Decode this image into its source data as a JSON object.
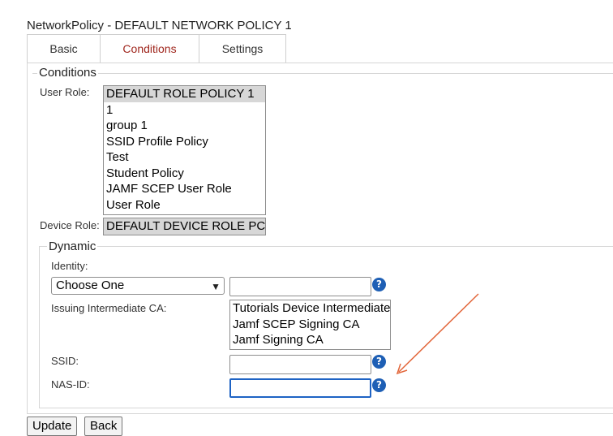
{
  "page": {
    "title": "NetworkPolicy - DEFAULT NETWORK POLICY 1"
  },
  "tabs": [
    {
      "label": "Basic"
    },
    {
      "label": "Conditions",
      "active": true
    },
    {
      "label": "Settings"
    }
  ],
  "conditions": {
    "legend": "Conditions",
    "user_role": {
      "label": "User Role:",
      "options": [
        "DEFAULT ROLE POLICY 1",
        "1",
        "group 1",
        "SSID Profile Policy",
        "Test",
        "Student Policy",
        "JAMF SCEP User Role",
        "User Role"
      ],
      "selected": "DEFAULT ROLE POLICY 1"
    },
    "device_role": {
      "label": "Device Role:",
      "value": "DEFAULT DEVICE ROLE PC"
    }
  },
  "dynamic": {
    "legend": "Dynamic",
    "identity": {
      "label": "Identity:",
      "select_value": "Choose One",
      "text_value": ""
    },
    "issuing_ca": {
      "label": "Issuing Intermediate CA:",
      "options": [
        "Tutorials Device Intermediate",
        "Jamf SCEP Signing CA",
        "Jamf Signing CA"
      ]
    },
    "ssid": {
      "label": "SSID:",
      "value": ""
    },
    "nas_id": {
      "label": "NAS-ID:",
      "value": ""
    },
    "help_glyph": "?"
  },
  "buttons": {
    "update": "Update",
    "back": "Back"
  },
  "colors": {
    "active_tab": "#a0271e",
    "help_icon": "#1e5fb5",
    "focus_ring": "#1e63c4",
    "annotation_arrow": "#e2663a"
  },
  "annotation": {
    "icon": "arrow-annotation"
  }
}
